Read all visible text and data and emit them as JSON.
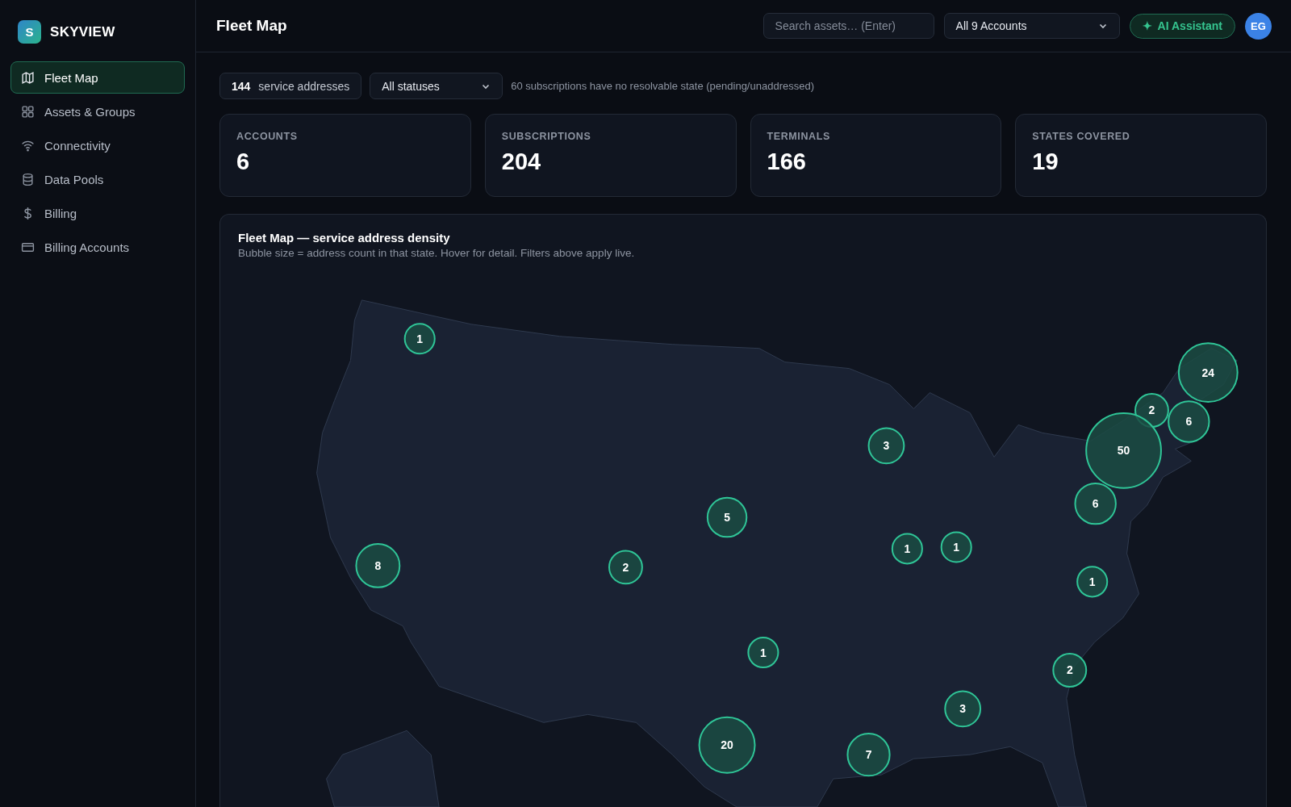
{
  "brand": {
    "logo_letter": "S",
    "name": "SKYVIEW"
  },
  "sidebar": {
    "items": [
      {
        "label": "Fleet Map",
        "selected": true
      },
      {
        "label": "Assets & Groups",
        "selected": false
      },
      {
        "label": "Connectivity",
        "selected": false
      },
      {
        "label": "Data Pools",
        "selected": false
      },
      {
        "label": "Billing",
        "selected": false
      },
      {
        "label": "Billing Accounts",
        "selected": false
      }
    ]
  },
  "header": {
    "title": "Fleet Map",
    "search": {
      "placeholder": "Search assets… (Enter)"
    },
    "account_select": "All 9 Accounts",
    "assistant_button": {
      "icon": "✦",
      "label": "AI Assistant"
    },
    "avatar": "EG"
  },
  "filters": {
    "count": "144",
    "count_label": "service addresses",
    "status_select": "All statuses",
    "note": "60 subscriptions have no resolvable state (pending/unaddressed)"
  },
  "stats": [
    {
      "label": "ACCOUNTS",
      "value": "6"
    },
    {
      "label": "SUBSCRIPTIONS",
      "value": "204"
    },
    {
      "label": "TERMINALS",
      "value": "166"
    },
    {
      "label": "STATES COVERED",
      "value": "19"
    }
  ],
  "map": {
    "title": "Fleet Map — service address density",
    "subtitle": "Bubble size = address count in that state. Hover for detail. Filters above apply live.",
    "bubbles": [
      {
        "label": "1"
      },
      {
        "label": "24"
      },
      {
        "label": "2"
      },
      {
        "label": "6"
      },
      {
        "label": "50"
      },
      {
        "label": "3"
      },
      {
        "label": "6"
      },
      {
        "label": "5"
      },
      {
        "label": "8"
      },
      {
        "label": "2"
      },
      {
        "label": "1"
      },
      {
        "label": "1"
      },
      {
        "label": "1"
      },
      {
        "label": "1"
      },
      {
        "label": "2"
      },
      {
        "label": "3"
      },
      {
        "label": "20"
      },
      {
        "label": "7"
      }
    ]
  }
}
